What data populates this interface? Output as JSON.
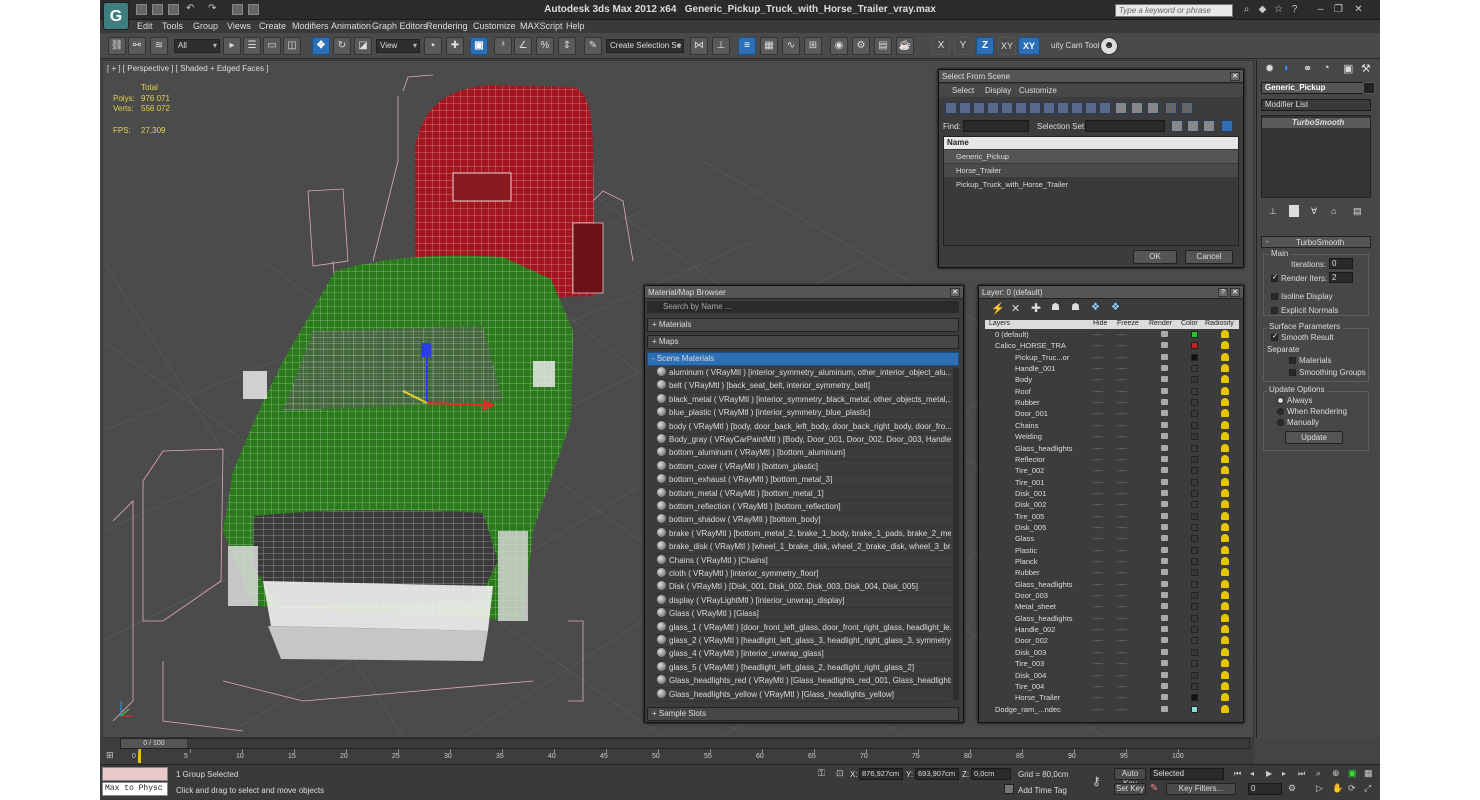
{
  "title": {
    "app": "Autodesk 3ds Max  2012 x64",
    "file": "Generic_Pickup_Truck_with_Horse_Trailer_vray.max"
  },
  "search_placeholder": "Type a keyword or phrase",
  "menu": [
    "Edit",
    "Tools",
    "Group",
    "Views",
    "Create",
    "Modifiers",
    "Animation",
    "Graph Editors",
    "Rendering",
    "Customize",
    "MAXScript",
    "Help"
  ],
  "toolbar": {
    "filter": "All",
    "refcoord": "View",
    "selset": "Create Selection Se",
    "axis": [
      "X",
      "Y",
      "Z",
      "XY"
    ],
    "plugin": "uity Cam Tool \\"
  },
  "viewport": {
    "label": "[ + ] [ Perspective ] [ Shaded + Edged Faces ]",
    "stats": {
      "total": "Total",
      "polys_label": "Polys:",
      "polys": "976 071",
      "verts_label": "Verts:",
      "verts": "556 072",
      "fps_label": "FPS:",
      "fps": "27,309"
    }
  },
  "select_from_scene": {
    "title": "Select From Scene",
    "menu": [
      "Select",
      "Display",
      "Customize"
    ],
    "find_label": "Find:",
    "selset_label": "Selection Set:",
    "col_name": "Name",
    "items": [
      "Generic_Pickup",
      "Horse_Trailer",
      "Pickup_Truck_with_Horse_Trailer"
    ],
    "ok": "OK",
    "cancel": "Cancel"
  },
  "material_browser": {
    "title": "Material/Map Browser",
    "search": "Search by Name ...",
    "rollouts": {
      "materials": "+ Materials",
      "maps": "+ Maps",
      "scene": "- Scene Materials",
      "slots": "+ Sample Slots"
    },
    "items": [
      "aluminum  ( VRayMtl )  [interior_symmetry_aluminum, other_interior_object_alu...",
      "belt  ( VRayMtl )  [back_seat_belt, interior_symmetry_belt]",
      "black_metal  ( VRayMtl )  [interior_symmetry_black_metal, other_objects_metal,...",
      "blue_plastic  ( VRayMtl )  [interior_symmetry_blue_plastic]",
      "body  ( VRayMtl )  [body, door_back_left_body, door_back_right_body, door_fro...",
      "Body_gray  ( VRayCarPaintMtl )  [Body, Door_001, Door_002, Door_003, Handle...",
      "bottom_aluminum  ( VRayMtl )  [bottom_aluminum]",
      "bottom_cover  ( VRayMtl )  [bottom_plastic]",
      "bottom_exhaust  ( VRayMtl )  [bottom_metal_3]",
      "bottom_metal  ( VRayMtl )  [bottom_metal_1]",
      "bottom_reflection  ( VRayMtl )  [bottom_reflection]",
      "bottom_shadow  ( VRayMtl )  [bottom_body]",
      "brake  ( VRayMtl )  [bottom_metal_2, brake_1_body, brake_1_pads, brake_2_me...",
      "brake_disk  ( VRayMtl )  [wheel_1_brake_disk, wheel_2_brake_disk, wheel_3_br...",
      "Chains  ( VRayMtl )  [Chains]",
      "cloth  ( VRayMtl )  [interior_symmetry_floor]",
      "Disk  ( VRayMtl )  [Disk_001, Disk_002, Disk_003, Disk_004, Disk_005]",
      "display  ( VRayLightMtl )  [interior_unwrap_display]",
      "Glass  ( VRayMtl )  [Glass]",
      "glass_1  ( VRayMtl )  [door_front_left_glass, door_front_right_glass, headlight_le...",
      "glass_2  ( VRayMtl )  [headlight_left_glass_3, headlight_right_glass_3, symmetry...",
      "glass_4  ( VRayMtl )  [interior_unwrap_glass]",
      "glass_5  ( VRayMtl )  [headlight_left_glass_2, headlight_right_glass_2]",
      "Glass_headlights_red  ( VRayMtl )  [Glass_headlights_red_001, Glass_headlights_...",
      "Glass_headlights_yellow  ( VRayMtl )  [Glass_headlights_yellow]"
    ]
  },
  "layer_manager": {
    "title": "Layer: 0 (default)",
    "cols": [
      "Layers",
      "Hide",
      "Freeze",
      "Render",
      "Color",
      "Radiosity"
    ],
    "rows": [
      {
        "name": "0 (default)",
        "color": "#2ec02e"
      },
      {
        "name": "Calico_HORSE_TRA",
        "color": "#d21e1e"
      },
      {
        "name": "Pickup_Truc...or",
        "color": "#111111"
      },
      {
        "name": "Handle_001",
        "color": "#3a3a3a"
      },
      {
        "name": "Body",
        "color": "#3a3a3a"
      },
      {
        "name": "Roof",
        "color": "#3a3a3a"
      },
      {
        "name": "Rubber",
        "color": "#3a3a3a"
      },
      {
        "name": "Door_001",
        "color": "#3a3a3a"
      },
      {
        "name": "Chains",
        "color": "#3a3a3a"
      },
      {
        "name": "Welding",
        "color": "#3a3a3a"
      },
      {
        "name": "Glass_headlights",
        "color": "#3a3a3a"
      },
      {
        "name": "Reflector",
        "color": "#3a3a3a"
      },
      {
        "name": "Tire_002",
        "color": "#3a3a3a"
      },
      {
        "name": "Tire_001",
        "color": "#3a3a3a"
      },
      {
        "name": "Disk_001",
        "color": "#3a3a3a"
      },
      {
        "name": "Disk_002",
        "color": "#3a3a3a"
      },
      {
        "name": "Tire_005",
        "color": "#3a3a3a"
      },
      {
        "name": "Disk_005",
        "color": "#3a3a3a"
      },
      {
        "name": "Glass",
        "color": "#3a3a3a"
      },
      {
        "name": "Plastic",
        "color": "#3a3a3a"
      },
      {
        "name": "Planck",
        "color": "#3a3a3a"
      },
      {
        "name": "Rubber",
        "color": "#3a3a3a"
      },
      {
        "name": "Glass_headlights",
        "color": "#3a3a3a"
      },
      {
        "name": "Door_003",
        "color": "#3a3a3a"
      },
      {
        "name": "Metal_sheet",
        "color": "#3a3a3a"
      },
      {
        "name": "Glass_headlights",
        "color": "#3a3a3a"
      },
      {
        "name": "Handle_002",
        "color": "#3a3a3a"
      },
      {
        "name": "Door_002",
        "color": "#3a3a3a"
      },
      {
        "name": "Disk_003",
        "color": "#3a3a3a"
      },
      {
        "name": "Tire_003",
        "color": "#3a3a3a"
      },
      {
        "name": "Disk_004",
        "color": "#3a3a3a"
      },
      {
        "name": "Tire_004",
        "color": "#3a3a3a"
      },
      {
        "name": "Horse_Trailer",
        "color": "#111111"
      },
      {
        "name": "Dodge_ram_...ndec",
        "color": "#8fd8d8"
      }
    ]
  },
  "command_panel": {
    "object_name": "Generic_Pickup",
    "modifier_list": "Modifier List",
    "stack_item": "TurboSmooth",
    "rollout": "TurboSmooth",
    "main": "Main",
    "iterations_label": "Iterations:",
    "iterations": "0",
    "render_iters_label": "Render Iters:",
    "render_iters": "2",
    "isoline": "Isoline Display",
    "explicit": "Explicit Normals",
    "surface": "Surface Parameters",
    "smooth_result": "Smooth Result",
    "separate": "Separate",
    "materials": "Materials",
    "smoothing_groups": "Smoothing Groups",
    "update_options": "Update Options",
    "always": "Always",
    "when_rendering": "When Rendering",
    "manually": "Manually",
    "update": "Update"
  },
  "timeline": {
    "frame": "0 / 100",
    "ticks": [
      "0",
      "5",
      "10",
      "15",
      "20",
      "25",
      "30",
      "35",
      "40",
      "45",
      "50",
      "55",
      "60",
      "65",
      "70",
      "75",
      "80",
      "85",
      "90",
      "95",
      "100"
    ]
  },
  "status": {
    "maxscript": "Max to Physc",
    "selection": "1 Group Selected",
    "prompt": "Click and drag to select and move objects",
    "x_label": "X:",
    "x": "876,927cm",
    "y_label": "Y:",
    "y": "693,907cm",
    "z_label": "Z:",
    "z": "0,0cm",
    "grid": "Grid = 80,0cm",
    "add_time_tag": "Add Time Tag",
    "auto_key": "Auto Key",
    "set_key": "Set Key",
    "selected": "Selected",
    "key_filters": "Key Filters...",
    "frame_value": "0"
  }
}
